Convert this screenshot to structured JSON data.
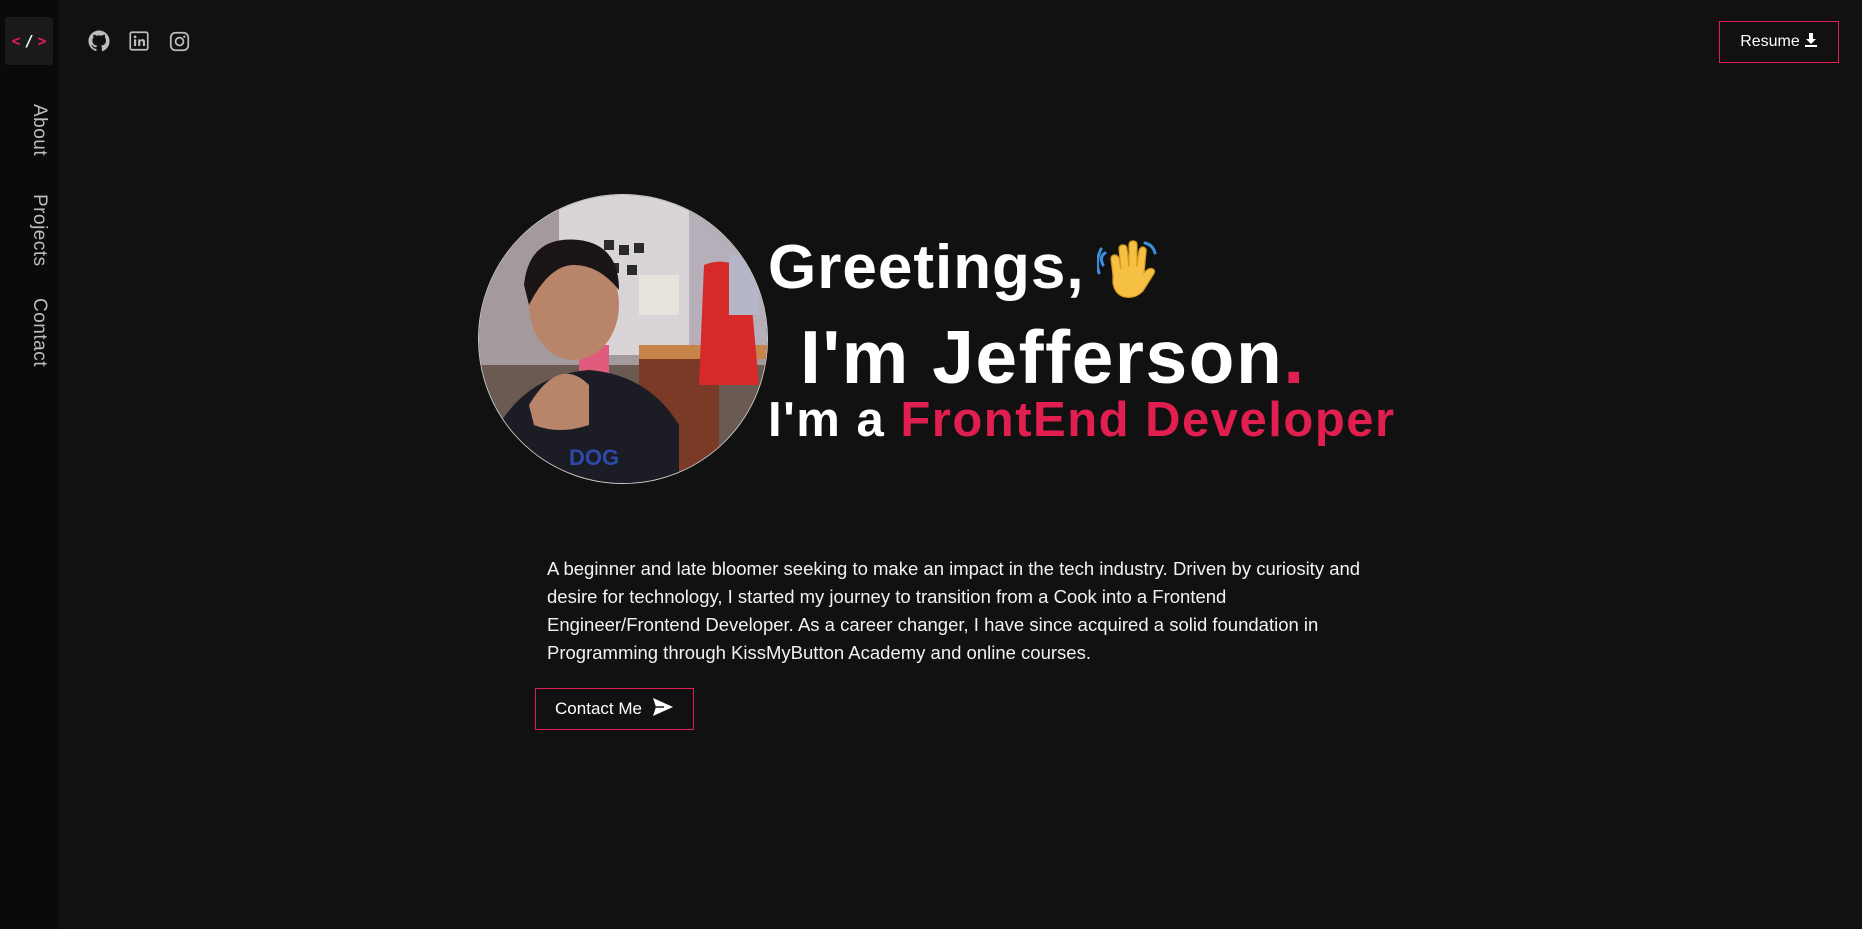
{
  "sidebar": {
    "logo": {
      "left": "<",
      "slash": "/",
      "right": ">"
    },
    "nav": [
      {
        "label": "About"
      },
      {
        "label": "Projects"
      },
      {
        "label": "Contact"
      }
    ]
  },
  "header": {
    "social_icons": [
      "github-icon",
      "linkedin-icon",
      "instagram-icon"
    ],
    "resume_label": "Resume"
  },
  "hero": {
    "greeting": "Greetings,",
    "name": "I'm Jefferson",
    "name_dot": ".",
    "role_prefix": "I'm a",
    "role": "FrontEnd Developer",
    "bio": "A beginner and late bloomer seeking to make an impact in the tech industry. Driven by curiosity and desire for technology, I started my journey to transition from a Cook into a Frontend Engineer/Frontend Developer. As a career changer, I have since acquired a solid foundation in Programming through KissMyButton Academy and online courses.",
    "contact_label": "Contact Me"
  },
  "colors": {
    "accent": "#e01e4f",
    "background": "#111111",
    "sidebar": "#0a0a0a"
  }
}
